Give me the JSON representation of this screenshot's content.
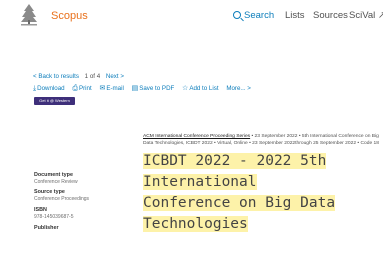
{
  "header": {
    "brand": "Scopus",
    "nav": {
      "search": "Search",
      "lists": "Lists",
      "sources": "Sources",
      "scival": "SciVal ↗"
    }
  },
  "result_nav": {
    "back": "< Back to results",
    "position": "1 of 4",
    "next": "Next >"
  },
  "actions": {
    "download": "Download",
    "print": "Print",
    "email": "E-mail",
    "save_pdf": "Save to PDF",
    "add_to_list": "Add to List",
    "more": "More... >"
  },
  "get_it": "Get it @ Western",
  "source": {
    "series": "ACM International Conference Proceeding Series",
    "series_rest": " • 23 September 2022 • 5th International Conference on Big",
    "details": "Data Technologies, ICBDT 2022 • Virtual, Online • 23 September 2022through 25 September 2022 • Code 18"
  },
  "meta": {
    "doc_type_label": "Document type",
    "doc_type_value": "Conference Review",
    "source_type_label": "Source type",
    "source_type_value": "Conference Proceedings",
    "isbn_label": "ISBN",
    "isbn_value": "978-145039687-5",
    "publisher_label": "Publisher"
  },
  "title": {
    "line1": "ICBDT 2022 - 2022 5th International",
    "line2": "Conference on Big Data Technologies"
  }
}
